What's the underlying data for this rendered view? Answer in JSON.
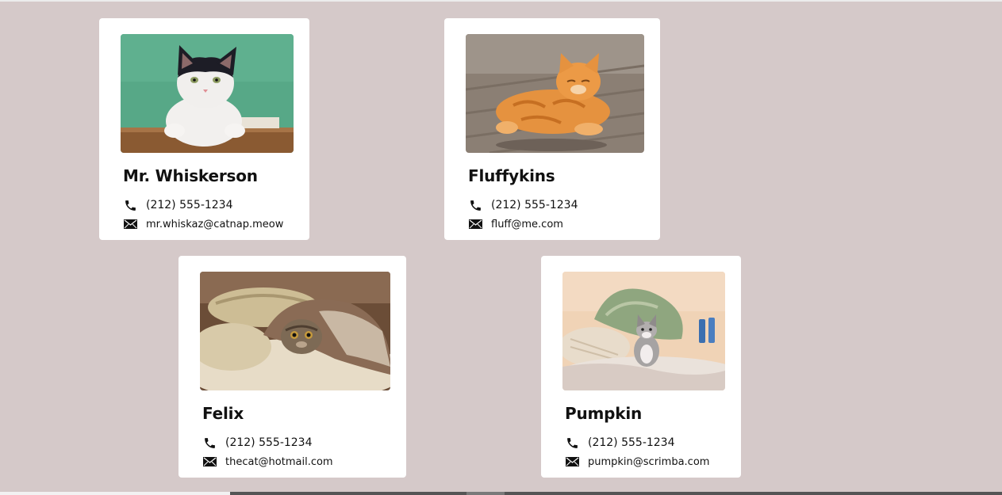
{
  "cards": [
    {
      "name": "Mr. Whiskerson",
      "phone": "(212) 555-1234",
      "email": "mr.whiskaz@catnap.meow",
      "photo": "black-white-cat-on-green-background"
    },
    {
      "name": "Fluffykins",
      "phone": "(212) 555-1234",
      "email": "fluff@me.com",
      "photo": "orange-tabby-cat-on-wood-floor"
    },
    {
      "name": "Felix",
      "phone": "(212) 555-1234",
      "email": "thecat@hotmail.com",
      "photo": "tabby-kitten-under-blanket"
    },
    {
      "name": "Pumpkin",
      "phone": "(212) 555-1234",
      "email": "pumpkin@scrimba.com",
      "photo": "grey-kitten-on-bed"
    }
  ],
  "icons": {
    "phone": "phone-icon",
    "email": "envelope-icon"
  },
  "colors": {
    "page_background": "#d5c9c9",
    "card_background": "#ffffff",
    "text": "#111111"
  }
}
